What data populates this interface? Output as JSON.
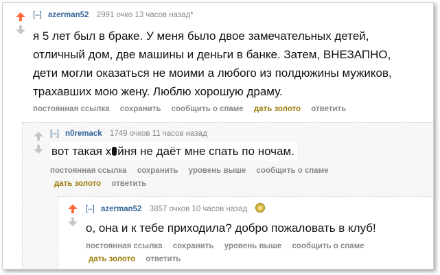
{
  "comments": [
    {
      "toggle": "[–]",
      "author": "azerman52",
      "meta": "2991 очко 13 часов назад*",
      "body_lines": [
        "я 5 лет был в браке. У меня было двое замечательных детей,",
        "отличный дом, две машины и деньги в банке. Затем, ВНЕЗАПНО,",
        "дети могли оказаться не моими а любого из полдюжины мужиков,",
        "трахавших мою жену. Люблю хорошую драму."
      ],
      "actions": [
        "постоянная ссылка",
        "сохранить",
        "сообщить о спаме",
        "дать золото",
        "ответить"
      ]
    },
    {
      "toggle": "[–]",
      "author": "n0remack",
      "meta": "1749 очков 11 часов назад",
      "body_before": "вот такая х",
      "body_after": "йня не даёт мне спать по ночам.",
      "actions_row1": [
        "постоянная ссылка",
        "сохранить",
        "уровень выше",
        "сообщить о спаме"
      ],
      "actions_row2": [
        "дать золото",
        "ответить"
      ]
    },
    {
      "toggle": "[–]",
      "author": "azerman52",
      "meta": "3857 очков 10 часов назад",
      "body": "о, она и к тебе приходила? добро пожаловать в клуб!",
      "actions_row1": [
        "постоянная ссылка",
        "сохранить",
        "уровень выше",
        "сообщить о спаме"
      ],
      "actions_row2": [
        "дать золото",
        "ответить"
      ]
    }
  ],
  "colors": {
    "upvote": "#ff6a3a",
    "neutral_vote": "#c6c6c6",
    "author": "#336699",
    "gold_action": "#9a7d0a"
  },
  "icons": {
    "upvote": "arrow-up-icon",
    "downvote": "arrow-down-icon",
    "gilded": "gold-coin-icon",
    "censored": "censor-blot-icon"
  }
}
